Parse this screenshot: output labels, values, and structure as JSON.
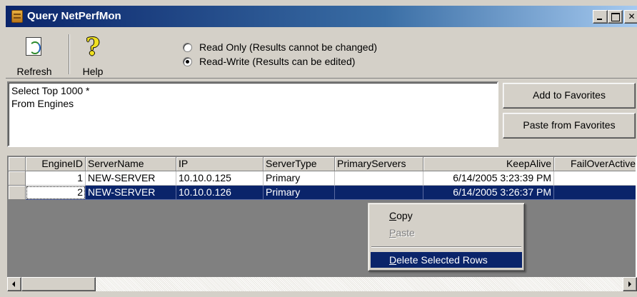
{
  "window": {
    "title": "Query NetPerfMon",
    "controls": {
      "minimize_icon": "minimize-icon",
      "maximize_icon": "maximize-icon",
      "close_icon": "close-icon"
    }
  },
  "toolbar": {
    "refresh_label": "Refresh",
    "help_label": "Help",
    "modes": [
      {
        "label": "Read Only (Results cannot be changed)",
        "checked": false
      },
      {
        "label": "Read-Write (Results can be edited)",
        "checked": true
      }
    ]
  },
  "query": {
    "text": "Select Top 1000 *\nFrom Engines"
  },
  "favorites": {
    "add_label": "Add to Favorites",
    "paste_label": "Paste from Favorites"
  },
  "grid": {
    "columns": [
      "EngineID",
      "ServerName",
      "IP",
      "ServerType",
      "PrimaryServers",
      "KeepAlive",
      "FailOverActive"
    ],
    "rows": [
      [
        "1",
        "NEW-SERVER",
        "10.10.0.125",
        "Primary",
        "",
        "6/14/2005 3:23:39 PM",
        ""
      ],
      [
        "2",
        "NEW-SERVER",
        "10.10.0.126",
        "Primary",
        "",
        "6/14/2005 3:26:37 PM",
        ""
      ]
    ],
    "selected_row": 1
  },
  "context_menu": {
    "items": [
      {
        "label": "Copy",
        "accel": "C",
        "rest": "opy",
        "enabled": true
      },
      {
        "label": "Paste",
        "accel": "P",
        "rest": "aste",
        "enabled": false
      },
      {
        "label": "Delete Selected Rows",
        "accel": "D",
        "rest": "elete Selected Rows",
        "enabled": true,
        "highlighted": true
      }
    ]
  },
  "colors": {
    "selection": "#0a246a",
    "face": "#d4d0c8",
    "grid_background": "#808080"
  }
}
